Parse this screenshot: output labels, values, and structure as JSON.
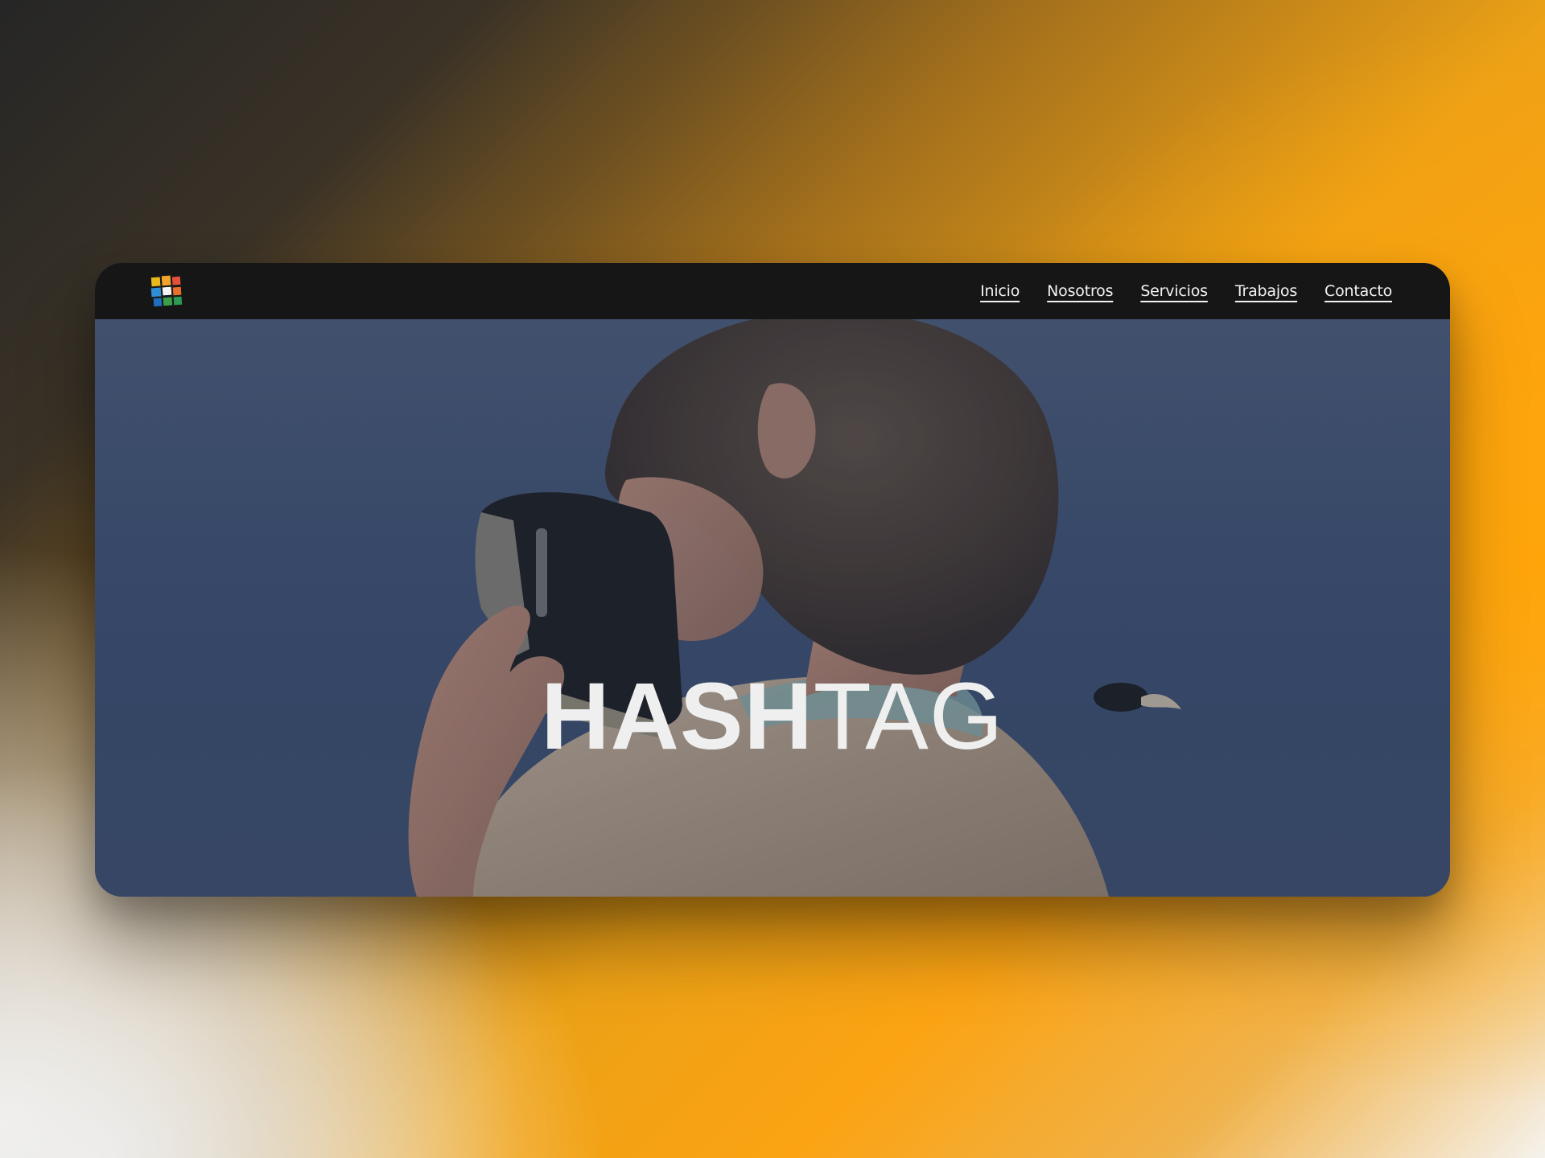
{
  "nav": {
    "items": [
      {
        "label": "Inicio"
      },
      {
        "label": "Nosotros"
      },
      {
        "label": "Servicios"
      },
      {
        "label": "Trabajos"
      },
      {
        "label": "Contacto"
      }
    ]
  },
  "hero": {
    "title_bold": "HASH",
    "title_light": "TAG"
  },
  "colors": {
    "navbar_bg": "#161616",
    "nav_text": "#f2f2f2",
    "hero_sky": "#3e5074",
    "title_text": "#efefef",
    "background_accent": "#fba313"
  },
  "icons": {
    "logo": "colorful-grid-logo"
  }
}
